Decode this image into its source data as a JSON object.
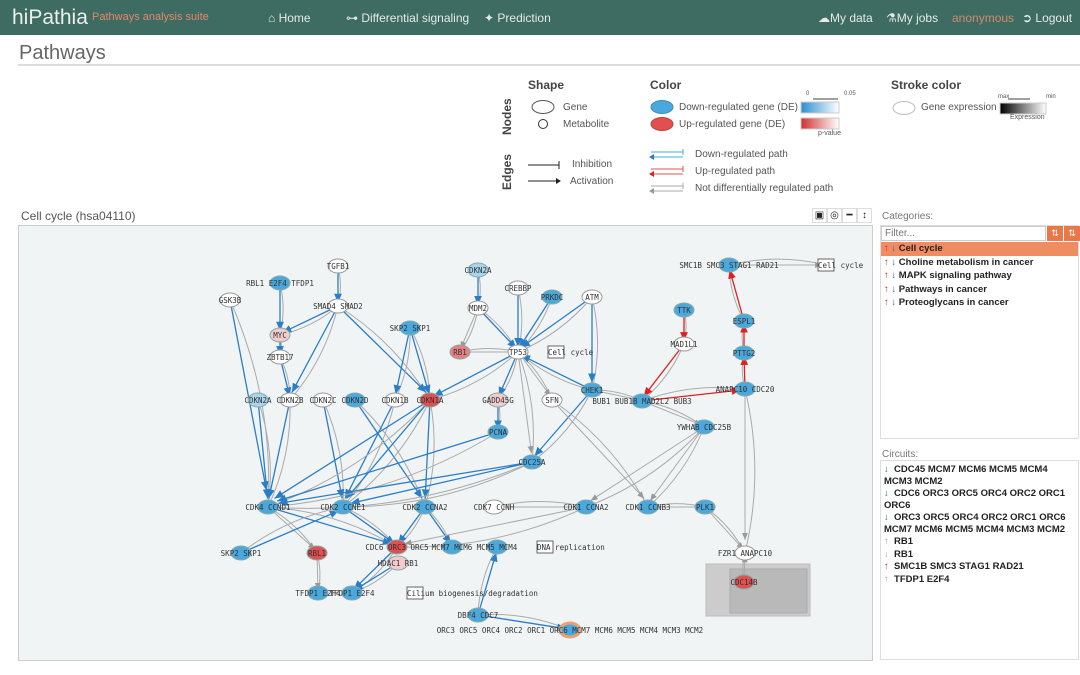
{
  "navbar": {
    "brand": "hiPathia",
    "subtitle": "Pathways analysis suite",
    "home": "Home",
    "diff": "Differential signaling",
    "prediction": "Prediction",
    "mydata": "My data",
    "myjobs": "My jobs",
    "user": "anonymous",
    "logout": "Logout"
  },
  "page_title": "Pathways",
  "legend": {
    "nodes_label": "Nodes",
    "edges_label": "Edges",
    "shape_title": "Shape",
    "gene": "Gene",
    "metabolite": "Metabolite",
    "color_title": "Color",
    "down_gene": "Down-regulated gene (DE)",
    "up_gene": "Up-regulated gene (DE)",
    "pval_min": "0",
    "pval_max": "0.05",
    "pvalue": "p-value",
    "stroke_title": "Stroke color",
    "gene_expression": "Gene expression",
    "expr_max": "max",
    "expr_min": "min",
    "expression": "Expression",
    "inhibition": "Inhibition",
    "activation": "Activation",
    "down_path": "Down-regulated path",
    "up_path": "Up-regulated path",
    "not_path": "Not differentially regulated path",
    "colors": {
      "down": "#4aa8dc",
      "up": "#e05050",
      "neutral": "#aaaaaa"
    }
  },
  "graph": {
    "title": "Cell cycle (hsa04110)",
    "tools": [
      "image-icon",
      "center-icon",
      "fit-width-icon",
      "fit-height-icon"
    ],
    "nodes": [
      {
        "label": "TGFB1",
        "c": "none"
      },
      {
        "label": "RBL1 E2F4 TFDP1",
        "c": "down"
      },
      {
        "label": "GSK3B",
        "c": "none"
      },
      {
        "label": "SMAD4 SMAD2",
        "c": "none"
      },
      {
        "label": "MYC",
        "c": "lup"
      },
      {
        "label": "ZBTB17",
        "c": "none"
      },
      {
        "label": "CDKN2A",
        "c": "ldown"
      },
      {
        "label": "MDM2",
        "c": "none"
      },
      {
        "label": "CREBBP",
        "c": "none"
      },
      {
        "label": "PRKDC",
        "c": "down"
      },
      {
        "label": "ATM",
        "c": "none"
      },
      {
        "label": "SKP2 SKP1",
        "c": "down"
      },
      {
        "label": "RB1",
        "c": "up2"
      },
      {
        "label": "TP53",
        "c": "none"
      },
      {
        "label": "Cell cycle",
        "c": "box"
      },
      {
        "label": "CDKN2A",
        "c": "ldown"
      },
      {
        "label": "CDKN2B",
        "c": "none"
      },
      {
        "label": "CDKN2C",
        "c": "none"
      },
      {
        "label": "CDKN2D",
        "c": "down"
      },
      {
        "label": "CDKN1B",
        "c": "none"
      },
      {
        "label": "CDKN1A",
        "c": "up"
      },
      {
        "label": "GADD45G",
        "c": "lup"
      },
      {
        "label": "SFN",
        "c": "none"
      },
      {
        "label": "CHEK1",
        "c": "down"
      },
      {
        "label": "BUB1 BUB1B MAD2L2 BUB3",
        "c": "down"
      },
      {
        "label": "TTK",
        "c": "down"
      },
      {
        "label": "MAD1L1",
        "c": "none"
      },
      {
        "label": "ESPL1",
        "c": "down"
      },
      {
        "label": "PTTG2",
        "c": "down"
      },
      {
        "label": "ANAPC10 CDC20",
        "c": "down"
      },
      {
        "label": "SMC1B SMC3 STAG1 RAD21",
        "c": "down"
      },
      {
        "label": "Cell cycle",
        "c": "box"
      },
      {
        "label": "PCNA",
        "c": "down"
      },
      {
        "label": "CDC25A",
        "c": "down"
      },
      {
        "label": "YWHAB CDC25B",
        "c": "down"
      },
      {
        "label": "CDK4 CCND1",
        "c": "down"
      },
      {
        "label": "CDK2 CCNE1",
        "c": "down"
      },
      {
        "label": "CDK2 CCNA2",
        "c": "down"
      },
      {
        "label": "CDK7 CCNH",
        "c": "none"
      },
      {
        "label": "CDK1 CCNA2",
        "c": "down"
      },
      {
        "label": "CDK1 CCNB3",
        "c": "down"
      },
      {
        "label": "PLK1",
        "c": "down"
      },
      {
        "label": "SKP2 SKP1",
        "c": "down"
      },
      {
        "label": "RBL1",
        "c": "up"
      },
      {
        "label": "CDC6 ORC3 ORC5",
        "c": "up"
      },
      {
        "label": "HDAC1 RB1",
        "c": "lup"
      },
      {
        "label": "MCM7 MCM6",
        "c": "down"
      },
      {
        "label": "MCM5 MCM4",
        "c": "down"
      },
      {
        "label": "DNA replication",
        "c": "box"
      },
      {
        "label": "FZR1 ANAPC10",
        "c": "none"
      },
      {
        "label": "CDC14B",
        "c": "up"
      },
      {
        "label": "TFDP1 E2F4",
        "c": "down"
      },
      {
        "label": "TFDP1 E2F4",
        "c": "down"
      },
      {
        "label": "Cilium biogenesis/degradation",
        "c": "box"
      },
      {
        "label": "DBF4 CDC7",
        "c": "down"
      },
      {
        "label": "ORC3 ORC5 ORC4 ORC2 ORC1 ORC6 MCM7 MCM6 MCM5 MCM4 MCM3 MCM2",
        "c": "down"
      }
    ],
    "edges": [
      [
        0,
        3,
        "d"
      ],
      [
        3,
        4,
        "d"
      ],
      [
        3,
        16,
        "d"
      ],
      [
        3,
        20,
        "d"
      ],
      [
        1,
        4,
        "d"
      ],
      [
        4,
        5,
        "d"
      ],
      [
        5,
        16,
        "d"
      ],
      [
        2,
        35,
        "d"
      ],
      [
        6,
        7,
        "d"
      ],
      [
        7,
        13,
        "d"
      ],
      [
        7,
        12,
        "n"
      ],
      [
        8,
        13,
        "d"
      ],
      [
        9,
        13,
        "d"
      ],
      [
        10,
        13,
        "d"
      ],
      [
        10,
        23,
        "d"
      ],
      [
        13,
        20,
        "d"
      ],
      [
        13,
        21,
        "d"
      ],
      [
        13,
        22,
        "n"
      ],
      [
        12,
        13,
        "n"
      ],
      [
        23,
        13,
        "d"
      ],
      [
        11,
        19,
        "d"
      ],
      [
        11,
        20,
        "d"
      ],
      [
        15,
        35,
        "d"
      ],
      [
        16,
        35,
        "d"
      ],
      [
        17,
        36,
        "d"
      ],
      [
        18,
        37,
        "d"
      ],
      [
        19,
        36,
        "d"
      ],
      [
        20,
        35,
        "d"
      ],
      [
        20,
        36,
        "d"
      ],
      [
        20,
        37,
        "d"
      ],
      [
        21,
        32,
        "d"
      ],
      [
        32,
        35,
        "d"
      ],
      [
        33,
        35,
        "d"
      ],
      [
        33,
        36,
        "d"
      ],
      [
        23,
        33,
        "d"
      ],
      [
        13,
        33,
        "n"
      ],
      [
        22,
        40,
        "n"
      ],
      [
        35,
        44,
        "d"
      ],
      [
        36,
        44,
        "d"
      ],
      [
        37,
        44,
        "d"
      ],
      [
        37,
        46,
        "d"
      ],
      [
        35,
        43,
        "n"
      ],
      [
        42,
        36,
        "d"
      ],
      [
        43,
        51,
        "n"
      ],
      [
        44,
        52,
        "d"
      ],
      [
        45,
        52,
        "d"
      ],
      [
        38,
        39,
        "n"
      ],
      [
        39,
        44,
        "n"
      ],
      [
        40,
        41,
        "n"
      ],
      [
        34,
        40,
        "n"
      ],
      [
        34,
        39,
        "n"
      ],
      [
        29,
        49,
        "n"
      ],
      [
        50,
        49,
        "n"
      ],
      [
        54,
        47,
        "d"
      ],
      [
        54,
        55,
        "d"
      ],
      [
        25,
        26,
        "u"
      ],
      [
        26,
        24,
        "u"
      ],
      [
        24,
        29,
        "u"
      ],
      [
        29,
        28,
        "u"
      ],
      [
        28,
        27,
        "u"
      ],
      [
        27,
        30,
        "u"
      ],
      [
        30,
        31,
        "n"
      ],
      [
        23,
        24,
        "n"
      ],
      [
        24,
        34,
        "n"
      ],
      [
        41,
        49,
        "n"
      ]
    ]
  },
  "categories": {
    "label": "Categories:",
    "filter_placeholder": "Filter...",
    "items": [
      "Cell cycle",
      "Choline metabolism in cancer",
      "MAPK signaling pathway",
      "Pathways in cancer",
      "Proteoglycans in cancer"
    ]
  },
  "circuits": {
    "label": "Circuits:",
    "items": [
      {
        "dir": "down",
        "text": "CDC45 MCM7 MCM6 MCM5 MCM4 MCM3 MCM2"
      },
      {
        "dir": "down",
        "text": "CDC6 ORC3 ORC5 ORC4 ORC2 ORC1 ORC6"
      },
      {
        "dir": "down",
        "text": "ORC3 ORC5 ORC4 ORC2 ORC1 ORC6 MCM7 MCM6 MCM5 MCM4 MCM3 MCM2"
      },
      {
        "dir": "up-gray",
        "text": "RB1"
      },
      {
        "dir": "down-gray",
        "text": "RB1"
      },
      {
        "dir": "up",
        "text": "SMC1B SMC3 STAG1 RAD21"
      },
      {
        "dir": "up-gray",
        "text": "TFDP1 E2F4"
      }
    ]
  }
}
